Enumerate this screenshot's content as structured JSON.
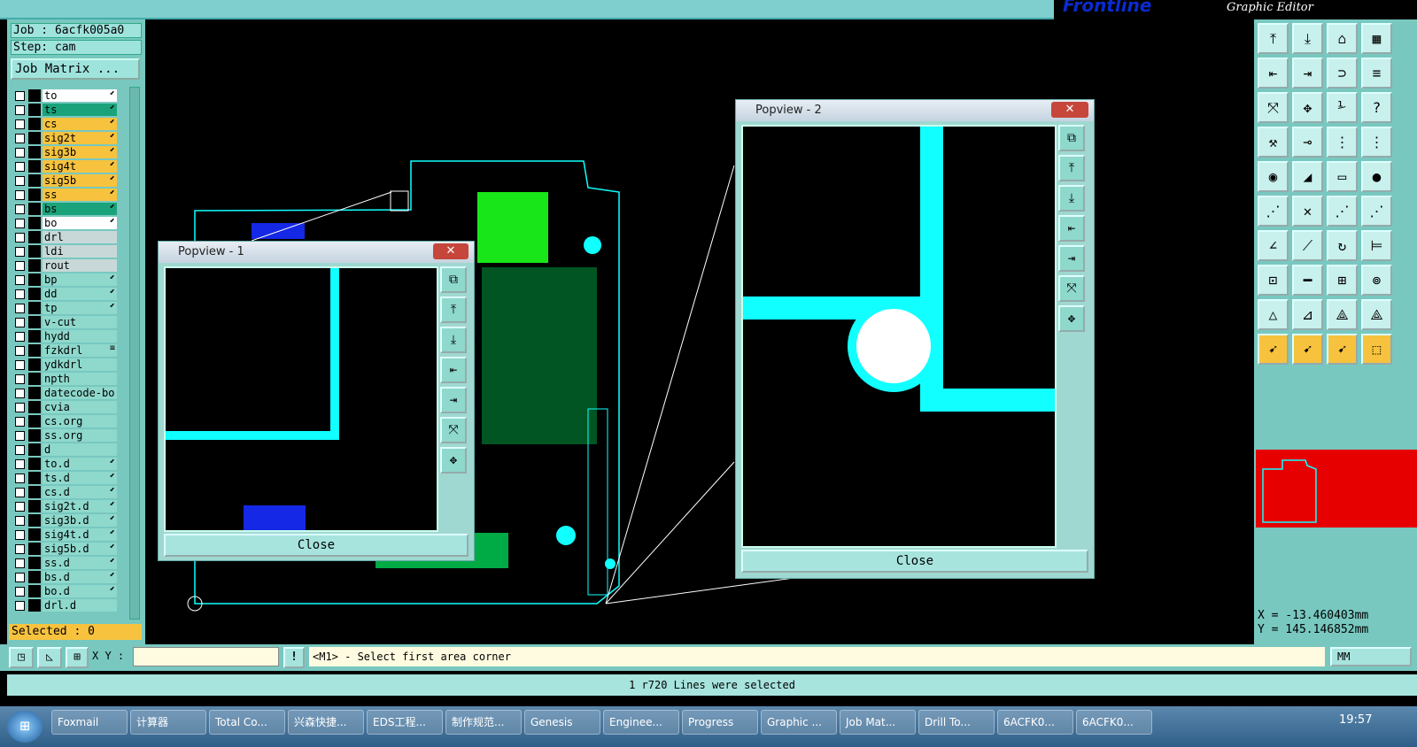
{
  "brand": {
    "logo": "Frontline",
    "subtitle": "Graphic Editor"
  },
  "job": {
    "label": "Job : 6acfk005a0",
    "step": "Step: cam",
    "matrix": "Job Matrix ..."
  },
  "layers": [
    {
      "name": "to",
      "color": "#ffffff",
      "mark": "⬋"
    },
    {
      "name": "ts",
      "color": "#1aa37a",
      "mark": "⬋"
    },
    {
      "name": "cs",
      "color": "#f7c23e",
      "mark": "⬋"
    },
    {
      "name": "sig2t",
      "color": "#f7c23e",
      "mark": "⬋"
    },
    {
      "name": "sig3b",
      "color": "#f7c23e",
      "mark": "⬋"
    },
    {
      "name": "sig4t",
      "color": "#f7c23e",
      "mark": "⬋"
    },
    {
      "name": "sig5b",
      "color": "#f7c23e",
      "mark": "⬋"
    },
    {
      "name": "ss",
      "color": "#f7c23e",
      "mark": "⬋"
    },
    {
      "name": "bs",
      "color": "#1aa37a",
      "mark": "⬋"
    },
    {
      "name": "bo",
      "color": "#ffffff",
      "mark": "⬋"
    },
    {
      "name": "drl",
      "color": "#c8d8d8",
      "mark": ""
    },
    {
      "name": "ldi",
      "color": "#c8d8d8",
      "mark": ""
    },
    {
      "name": "rout",
      "color": "#c8d8d8",
      "mark": ""
    },
    {
      "name": "bp",
      "color": "#8ed8cc",
      "mark": "⬋"
    },
    {
      "name": "dd",
      "color": "#8ed8cc",
      "mark": "⬋"
    },
    {
      "name": "tp",
      "color": "#8ed8cc",
      "mark": "⬋"
    },
    {
      "name": "v-cut",
      "color": "#8ed8cc",
      "mark": ""
    },
    {
      "name": "hydd",
      "color": "#8ed8cc",
      "mark": ""
    },
    {
      "name": "fzkdrl",
      "color": "#8ed8cc",
      "mark": "≡"
    },
    {
      "name": "ydkdrl",
      "color": "#8ed8cc",
      "mark": ""
    },
    {
      "name": "npth",
      "color": "#8ed8cc",
      "mark": ""
    },
    {
      "name": "datecode-bo",
      "color": "#8ed8cc",
      "mark": ""
    },
    {
      "name": "cvia",
      "color": "#8ed8cc",
      "mark": ""
    },
    {
      "name": "cs.org",
      "color": "#8ed8cc",
      "mark": ""
    },
    {
      "name": "ss.org",
      "color": "#8ed8cc",
      "mark": ""
    },
    {
      "name": "d",
      "color": "#8ed8cc",
      "mark": ""
    },
    {
      "name": "to.d",
      "color": "#8ed8cc",
      "mark": "⬋"
    },
    {
      "name": "ts.d",
      "color": "#8ed8cc",
      "mark": "⬋"
    },
    {
      "name": "cs.d",
      "color": "#8ed8cc",
      "mark": "⬋"
    },
    {
      "name": "sig2t.d",
      "color": "#8ed8cc",
      "mark": "⬋"
    },
    {
      "name": "sig3b.d",
      "color": "#8ed8cc",
      "mark": "⬋"
    },
    {
      "name": "sig4t.d",
      "color": "#8ed8cc",
      "mark": "⬋"
    },
    {
      "name": "sig5b.d",
      "color": "#8ed8cc",
      "mark": "⬋"
    },
    {
      "name": "ss.d",
      "color": "#8ed8cc",
      "mark": "⬋"
    },
    {
      "name": "bs.d",
      "color": "#8ed8cc",
      "mark": "⬋"
    },
    {
      "name": "bo.d",
      "color": "#8ed8cc",
      "mark": "⬋"
    },
    {
      "name": "drl.d",
      "color": "#8ed8cc",
      "mark": ""
    }
  ],
  "selected": "Selected : 0",
  "popview1": {
    "title": "Popview - 1",
    "close": "Close"
  },
  "popview2": {
    "title": "Popview - 2",
    "close": "Close"
  },
  "coords": {
    "x": "X = -13.460403mm",
    "y": "Y = 145.146852mm"
  },
  "cmd": {
    "xy_label": "X Y :",
    "prompt": "<M1> - Select first area corner",
    "unit": "MM"
  },
  "status": "1 r720 Lines were selected",
  "taskbar": [
    "Foxmail",
    "计算器",
    "Total Co...",
    "兴森快捷...",
    "EDS工程...",
    "制作规范...",
    "Genesis",
    "Enginee...",
    "Progress",
    "Graphic ...",
    "Job Mat...",
    "Drill To...",
    "6ACFK0...",
    "6ACFK0..."
  ],
  "time": "19:57"
}
